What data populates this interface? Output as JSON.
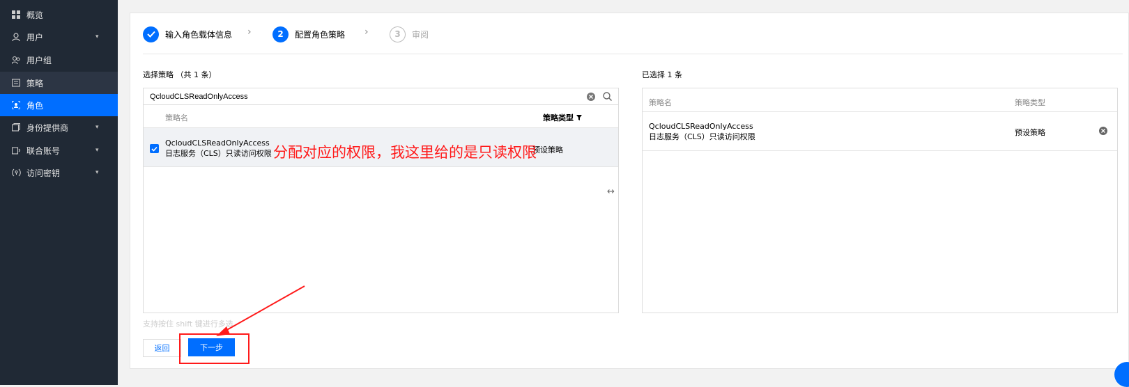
{
  "sidebar": {
    "items": [
      {
        "label": "概览",
        "icon": "grid-icon",
        "chevron": false
      },
      {
        "label": "用户",
        "icon": "user-icon",
        "chevron": true
      },
      {
        "label": "用户组",
        "icon": "user-group-icon",
        "chevron": false
      },
      {
        "label": "策略",
        "icon": "policy-icon",
        "chevron": false
      },
      {
        "label": "角色",
        "icon": "role-icon",
        "chevron": false
      },
      {
        "label": "身份提供商",
        "icon": "identity-provider-icon",
        "chevron": true
      },
      {
        "label": "联合账号",
        "icon": "federated-account-icon",
        "chevron": true
      },
      {
        "label": "访问密钥",
        "icon": "access-key-icon",
        "chevron": true
      }
    ]
  },
  "steps": [
    {
      "num": "",
      "label": "输入角色载体信息",
      "state": "done"
    },
    {
      "num": "2",
      "label": "配置角色策略",
      "state": "current"
    },
    {
      "num": "3",
      "label": "审阅",
      "state": "todo"
    }
  ],
  "left": {
    "title": "选择策略 （共 1 条）",
    "search_value": "QcloudCLSReadOnlyAccess",
    "col_name": "策略名",
    "col_type": "策略类型",
    "rows": [
      {
        "name": "QcloudCLSReadOnlyAccess",
        "desc": "日志服务（CLS）只读访问权限",
        "type": "预设策略",
        "checked": true
      }
    ],
    "hint": "支持按住 shift 键进行多选"
  },
  "right": {
    "title": "已选择 1 条",
    "col_name": "策略名",
    "col_type": "策略类型",
    "rows": [
      {
        "name": "QcloudCLSReadOnlyAccess",
        "desc": "日志服务（CLS）只读访问权限",
        "type": "预设策略"
      }
    ]
  },
  "buttons": {
    "back": "返回",
    "next": "下一步"
  },
  "annotation": {
    "text": "分配对应的权限，我这里给的是只读权限",
    "color": "#ff1a1a"
  },
  "colors": {
    "accent": "#006eff",
    "sidebar_bg": "#202935"
  }
}
